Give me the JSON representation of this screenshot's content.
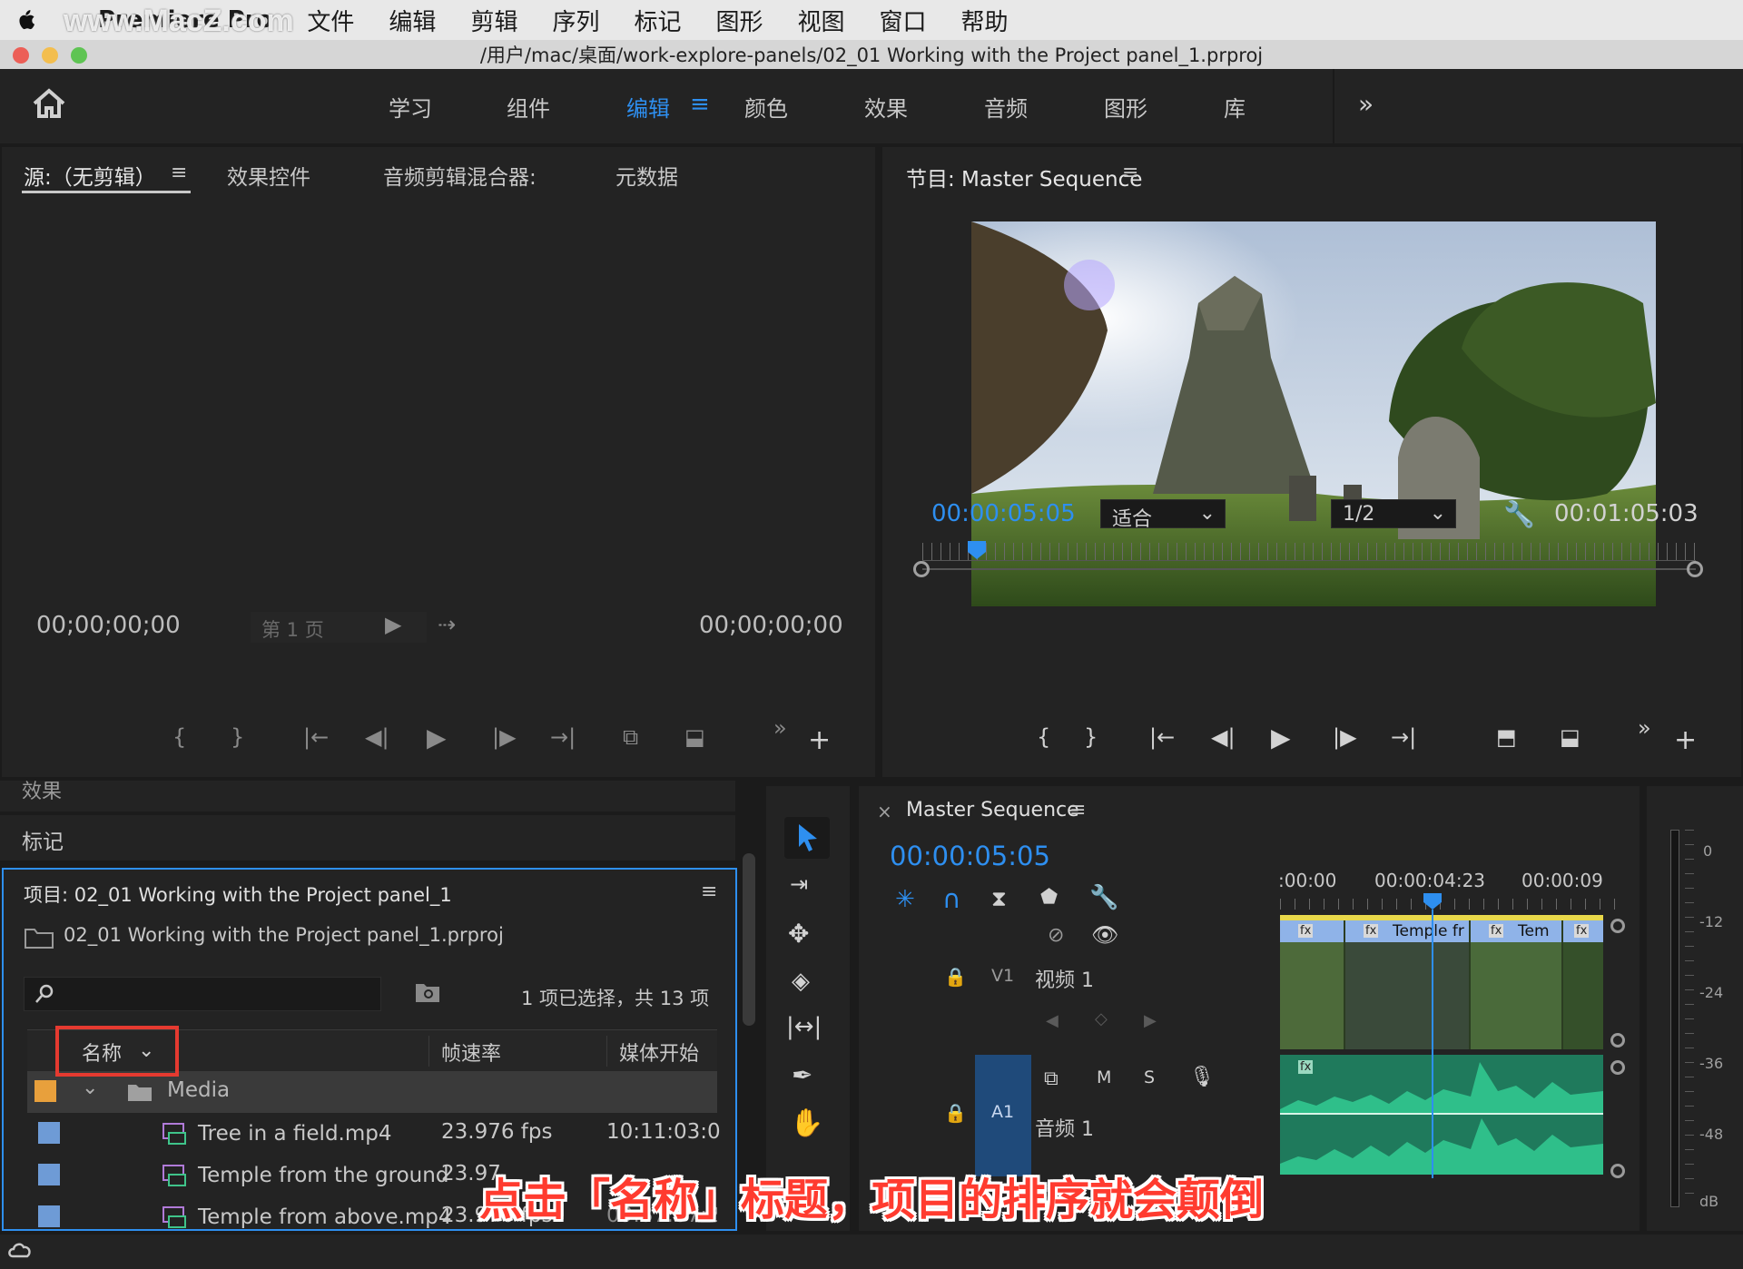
{
  "menubar": {
    "app_name": "Premiere Pro",
    "watermark": "www.MacZ.com",
    "items": [
      "文件",
      "编辑",
      "剪辑",
      "序列",
      "标记",
      "图形",
      "视图",
      "窗口",
      "帮助"
    ]
  },
  "window": {
    "title": "/用户/mac/桌面/work-explore-panels/02_01 Working with the Project panel_1.prproj"
  },
  "workspaces": {
    "tabs": [
      "学习",
      "组件",
      "编辑",
      "颜色",
      "效果",
      "音频",
      "图形",
      "库"
    ],
    "active": "编辑",
    "more": "»"
  },
  "source_panel": {
    "tabs": [
      "源:（无剪辑）",
      "效果控件",
      "音频剪辑混合器:",
      "元数据"
    ],
    "timecode_left": "00;00;00;00",
    "timecode_right": "00;00;00;00",
    "page_label": "第 1 页"
  },
  "program_panel": {
    "title": "节目: Master Sequence",
    "timecode_current": "00:00:05:05",
    "fit_option": "适合",
    "resolution": "1/2",
    "timecode_duration": "00:01:05:03"
  },
  "effects_tab": "效果",
  "markers_tab": "标记",
  "project_panel": {
    "title": "项目: 02_01 Working with the Project panel_1",
    "file_name": "02_01 Working with the Project panel_1.prproj",
    "search_placeholder": "",
    "selection_info": "1 项已选择，共 13 项",
    "columns": [
      "名称",
      "帧速率",
      "媒体开始"
    ],
    "bin": {
      "name": "Media",
      "color": "#e8a03c"
    },
    "items": [
      {
        "name": "Tree in a field.mp4",
        "fps": "23.976 fps",
        "start": "10:11:03:0",
        "color": "#6e9bd6"
      },
      {
        "name": "Temple from the ground",
        "fps": "23.97",
        "start": "",
        "color": "#6e9bd6"
      },
      {
        "name": "Temple from above.mp4",
        "fps": "23.976 fps",
        "start": "09:37:07:2",
        "color": "#6e9bd6"
      }
    ]
  },
  "timeline": {
    "sequence_name": "Master Sequence",
    "timecode": "00:00:05:05",
    "ruler_labels": [
      ":00:00",
      "00:00:04:23",
      "00:00:09"
    ],
    "video_track": {
      "id": "V1",
      "name": "视频 1"
    },
    "audio_track": {
      "id": "A1",
      "name": "音频 1",
      "m": "M",
      "s": "S"
    },
    "clips": [
      "Temple fr",
      "Tem"
    ],
    "fx": "fx"
  },
  "meter": {
    "labels": [
      "0",
      "-12",
      "-24",
      "-36",
      "-48",
      "dB"
    ]
  },
  "caption": "点击「名称」标题，项目的排序就会颠倒",
  "colors": {
    "accent_blue": "#2e8ff0",
    "highlight_red": "#e53a30",
    "audio_green": "#2fbf8a",
    "video_clip_header": "#8fb3e8",
    "panel_bg": "#232323"
  }
}
